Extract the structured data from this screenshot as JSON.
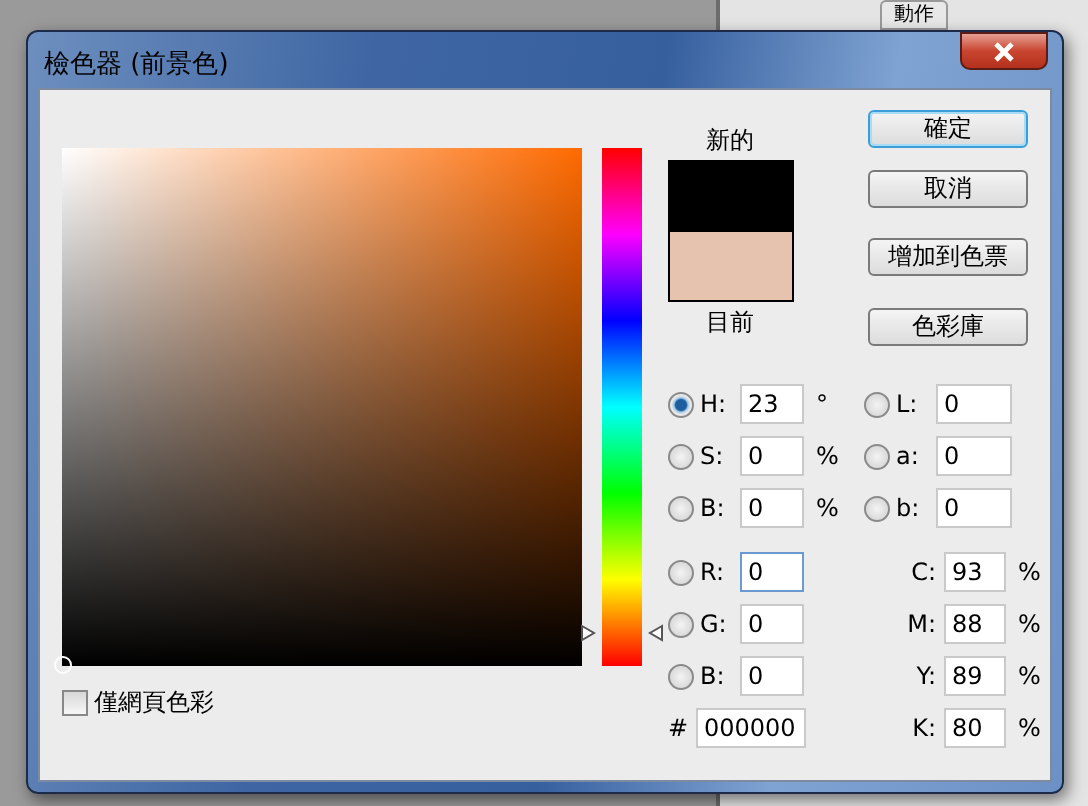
{
  "background": {
    "tabs": [
      {
        "label": "動作"
      }
    ]
  },
  "window": {
    "title": "檢色器 (前景色)"
  },
  "hue_slider": {
    "level": 0.064
  },
  "swatch": {
    "new_label": "新的",
    "current_label": "目前"
  },
  "buttons": [
    {
      "label": "確定",
      "default": true
    },
    {
      "label": "取消",
      "default": false
    },
    {
      "label": "增加到色票",
      "default": false
    },
    {
      "label": "色彩庫",
      "default": false
    }
  ],
  "hsb": [
    {
      "label": "H:",
      "value": "23",
      "unit": "°",
      "selected": true
    },
    {
      "label": "S:",
      "value": "0",
      "unit": "%",
      "selected": false
    },
    {
      "label": "B:",
      "value": "0",
      "unit": "%",
      "selected": false
    }
  ],
  "lab": [
    {
      "label": "L:",
      "value": "0",
      "selected": false
    },
    {
      "label": "a:",
      "value": "0",
      "selected": false
    },
    {
      "label": "b:",
      "value": "0",
      "selected": false
    }
  ],
  "rgb": [
    {
      "label": "R:",
      "value": "0",
      "selected": false
    },
    {
      "label": "G:",
      "value": "0",
      "selected": false
    },
    {
      "label": "B:",
      "value": "0",
      "selected": false
    }
  ],
  "cmyk": [
    {
      "label": "C:",
      "value": "93",
      "unit": "%"
    },
    {
      "label": "M:",
      "value": "88",
      "unit": "%"
    },
    {
      "label": "Y:",
      "value": "89",
      "unit": "%"
    },
    {
      "label": "K:",
      "value": "80",
      "unit": "%"
    }
  ],
  "hex": {
    "label": "#",
    "value": "000000"
  },
  "web_only": {
    "label": "僅網頁色彩",
    "checked": false
  }
}
